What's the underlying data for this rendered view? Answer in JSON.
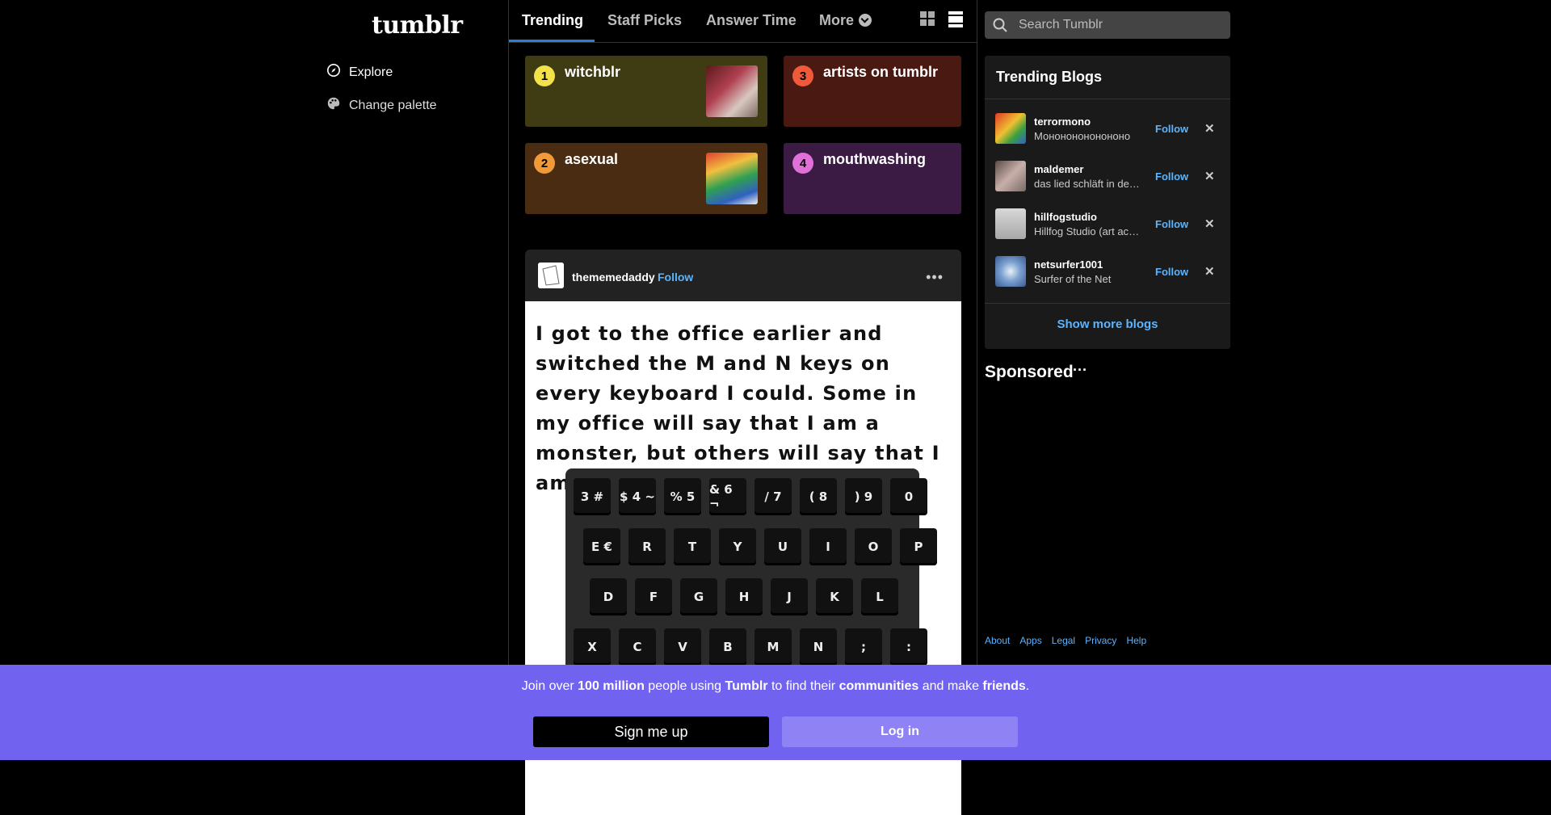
{
  "brand": {
    "logo": "tumblr"
  },
  "sidebar": {
    "items": [
      {
        "label": "Explore",
        "icon": "compass-icon"
      },
      {
        "label": "Change palette",
        "icon": "palette-icon"
      }
    ]
  },
  "tabs": [
    {
      "label": "Trending",
      "active": true
    },
    {
      "label": "Staff Picks"
    },
    {
      "label": "Answer Time"
    },
    {
      "label": "More"
    }
  ],
  "trending_tags": [
    {
      "rank": "1",
      "label": "witchblr",
      "color": "#3f3b12",
      "badge": "#f3e24a"
    },
    {
      "rank": "2",
      "label": "asexual",
      "color": "#4a2c12",
      "badge": "#f29a3a"
    },
    {
      "rank": "3",
      "label": "artists on tumblr",
      "color": "#4a1a12",
      "badge": "#f05a3a"
    },
    {
      "rank": "4",
      "label": "mouthwashing",
      "color": "#3b1a44",
      "badge": "#e070d8"
    }
  ],
  "post": {
    "username": "thememedaddy",
    "follow_label": "Follow",
    "menu_label": "•••",
    "meme_text": "I got to the office earlier and switched the M and N keys on every keyboard I could. Some in my office will say that I am a monster, but others will say that I am a nomster.",
    "keyboard_rows": [
      [
        "3 #",
        "$ 4 ~",
        "% 5",
        "& 6 ¬",
        "/ 7",
        "( 8",
        ") 9",
        "0"
      ],
      [
        "E €",
        "R",
        "T",
        "Y",
        "U",
        "I",
        "O",
        "P"
      ],
      [
        "D",
        "F",
        "G",
        "H",
        "J",
        "K",
        "L"
      ],
      [
        "X",
        "C",
        "V",
        "B",
        "M",
        "N",
        ";",
        ":"
      ]
    ]
  },
  "search": {
    "placeholder": "Search Tumblr"
  },
  "trending_blogs": {
    "title": "Trending Blogs",
    "follow_label": "Follow",
    "blogs": [
      {
        "name": "terrormono",
        "desc": "Монононононононо"
      },
      {
        "name": "maldemer",
        "desc": "das lied schläft in der maschine"
      },
      {
        "name": "hillfogstudio",
        "desc": "Hillfog Studio (art account)"
      },
      {
        "name": "netsurfer1001",
        "desc": "Surfer of the Net"
      }
    ],
    "show_more": "Show more blogs"
  },
  "sponsored": {
    "label": "Sponsored",
    "menu": "···"
  },
  "footer": {
    "links": [
      "About",
      "Apps",
      "Legal",
      "Privacy",
      "Help"
    ]
  },
  "banner": {
    "text_1": "Join over ",
    "text_2": "100 million",
    "text_3": " people using ",
    "text_4": "Tumblr",
    "text_5": " to find their ",
    "text_6": "communities",
    "text_7": " and make ",
    "text_8": "friends",
    "text_9": ".",
    "signup_label": "Sign me up",
    "login_label": "Log in"
  }
}
